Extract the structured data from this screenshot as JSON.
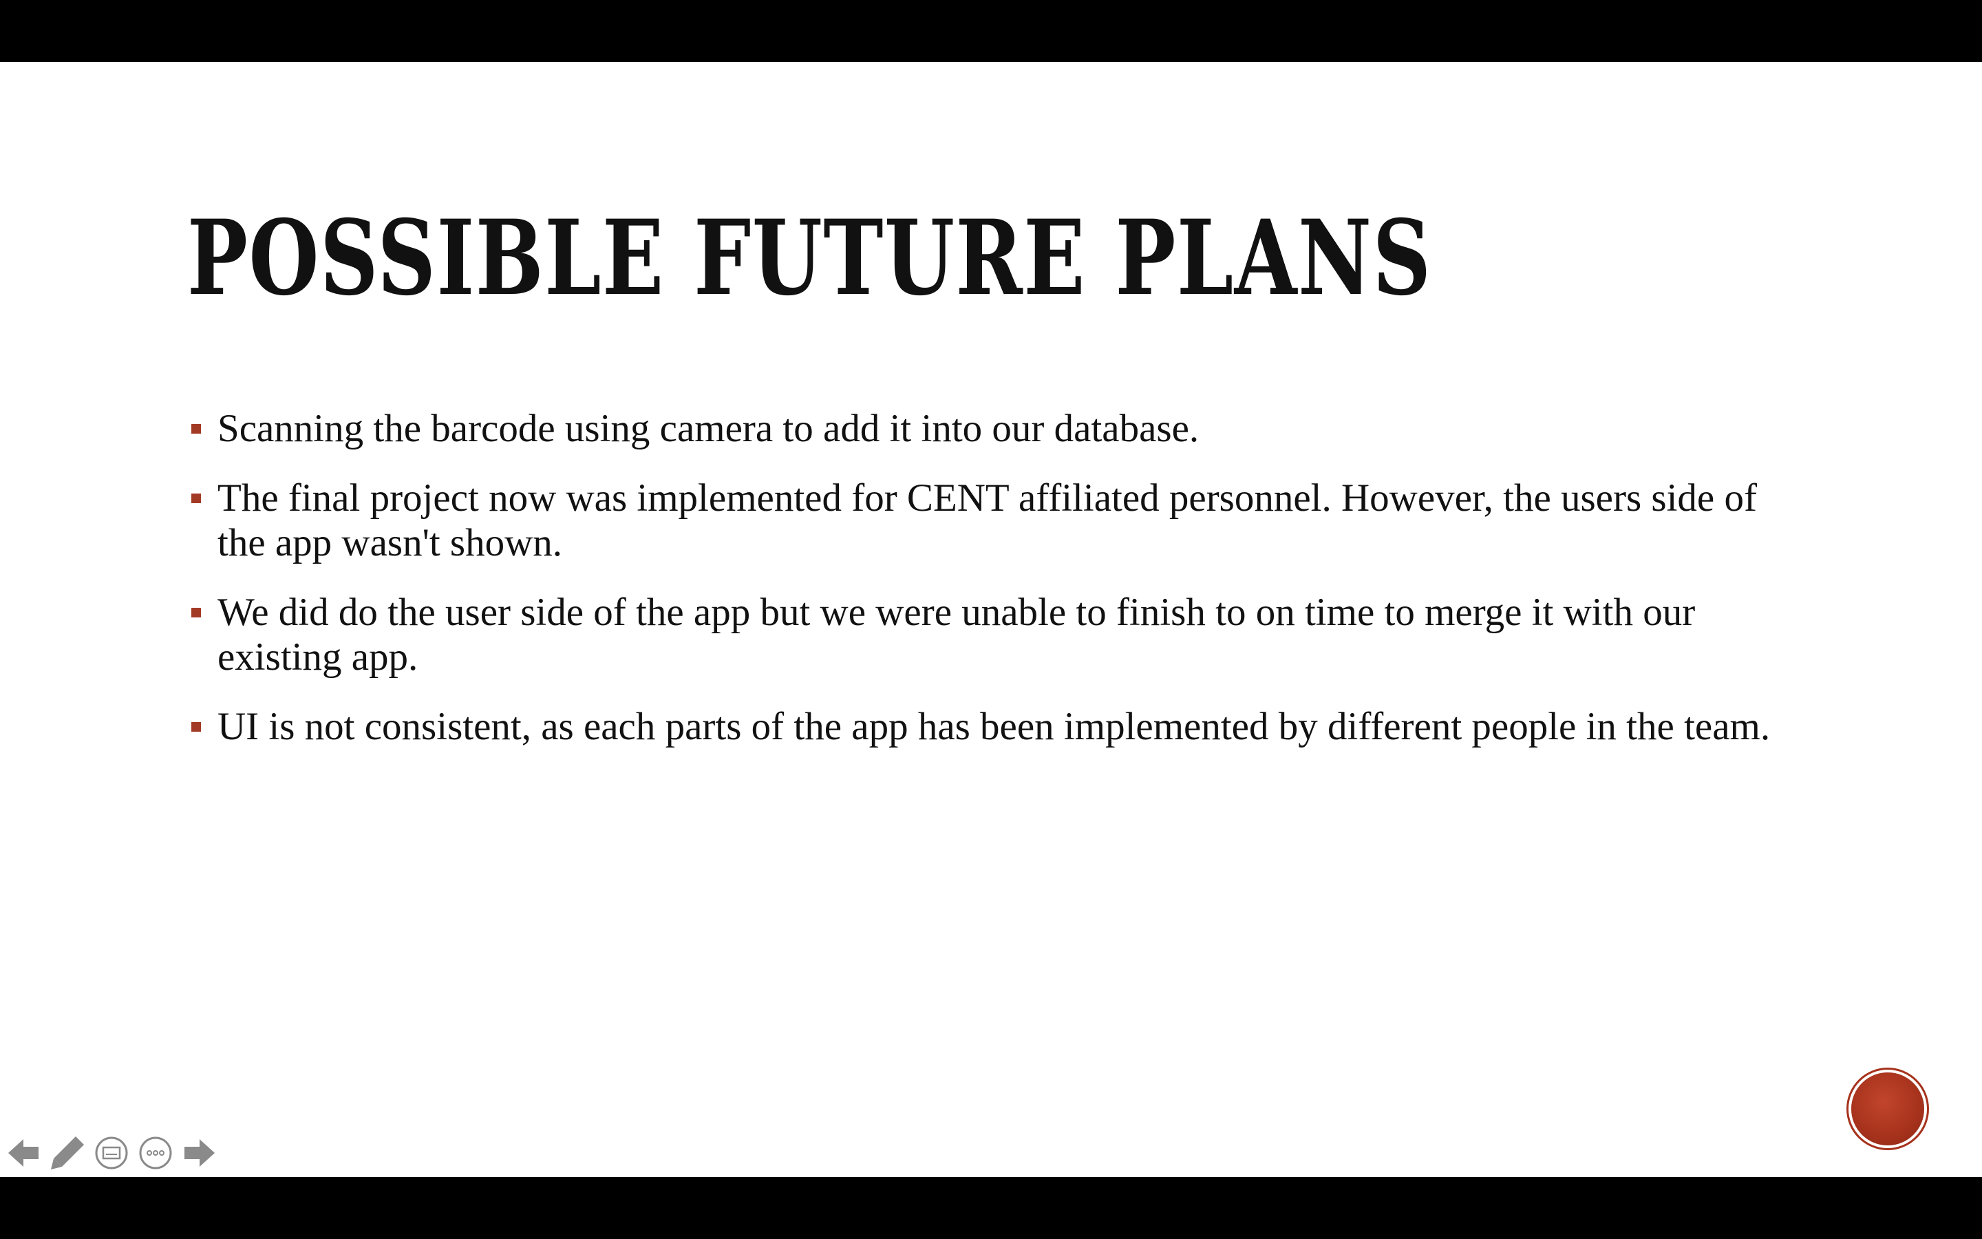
{
  "slide": {
    "title": "POSSIBLE FUTURE PLANS",
    "bullets": [
      "Scanning the barcode using camera to add it into our database.",
      "The final project now was implemented for CENT affiliated personnel. However, the users side of the app wasn't shown.",
      "We did do the user side of the app but we were unable to finish to on time to merge it with our existing app.",
      "UI is not consistent, as each parts of the app has been implemented by different people in the team."
    ]
  },
  "nav_controls": {
    "icons": [
      "previous-arrow-icon",
      "pen-icon",
      "slides-grid-icon",
      "more-options-icon",
      "next-arrow-icon"
    ],
    "icon_color": "#8a8a8a"
  },
  "colors": {
    "accent": "#a33a25",
    "title_text": "#111111",
    "background": "#ffffff",
    "letterbox": "#000000"
  }
}
